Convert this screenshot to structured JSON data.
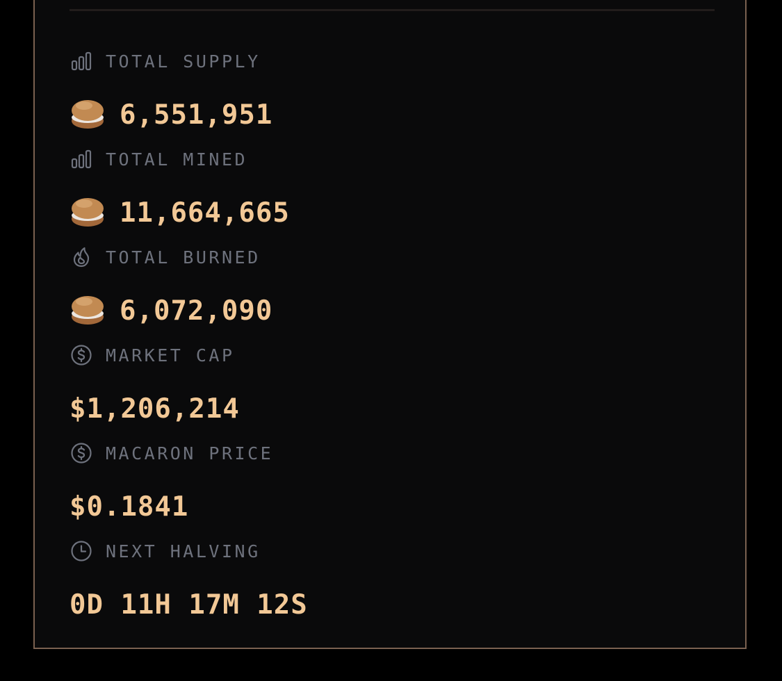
{
  "colors": {
    "background": "#000000",
    "panel": "#0a0a0b",
    "panel_border": "#7a6150",
    "label": "#6e727d",
    "value": "#f2c896"
  },
  "stats": [
    {
      "icon": "bar-chart-icon",
      "label": "TOTAL SUPPLY",
      "value": "6,551,951",
      "has_macaron": true
    },
    {
      "icon": "bar-chart-icon",
      "label": "TOTAL MINED",
      "value": "11,664,665",
      "has_macaron": true
    },
    {
      "icon": "flame-icon",
      "label": "TOTAL BURNED",
      "value": "6,072,090",
      "has_macaron": true
    },
    {
      "icon": "dollar-circle-icon",
      "label": "MARKET CAP",
      "value": "$1,206,214",
      "has_macaron": false
    },
    {
      "icon": "dollar-circle-icon",
      "label": "MACARON PRICE",
      "value": "$0.1841",
      "has_macaron": false
    },
    {
      "icon": "clock-icon",
      "label": "NEXT HALVING",
      "value": "0D 11H 17M 12S",
      "has_macaron": false
    }
  ]
}
